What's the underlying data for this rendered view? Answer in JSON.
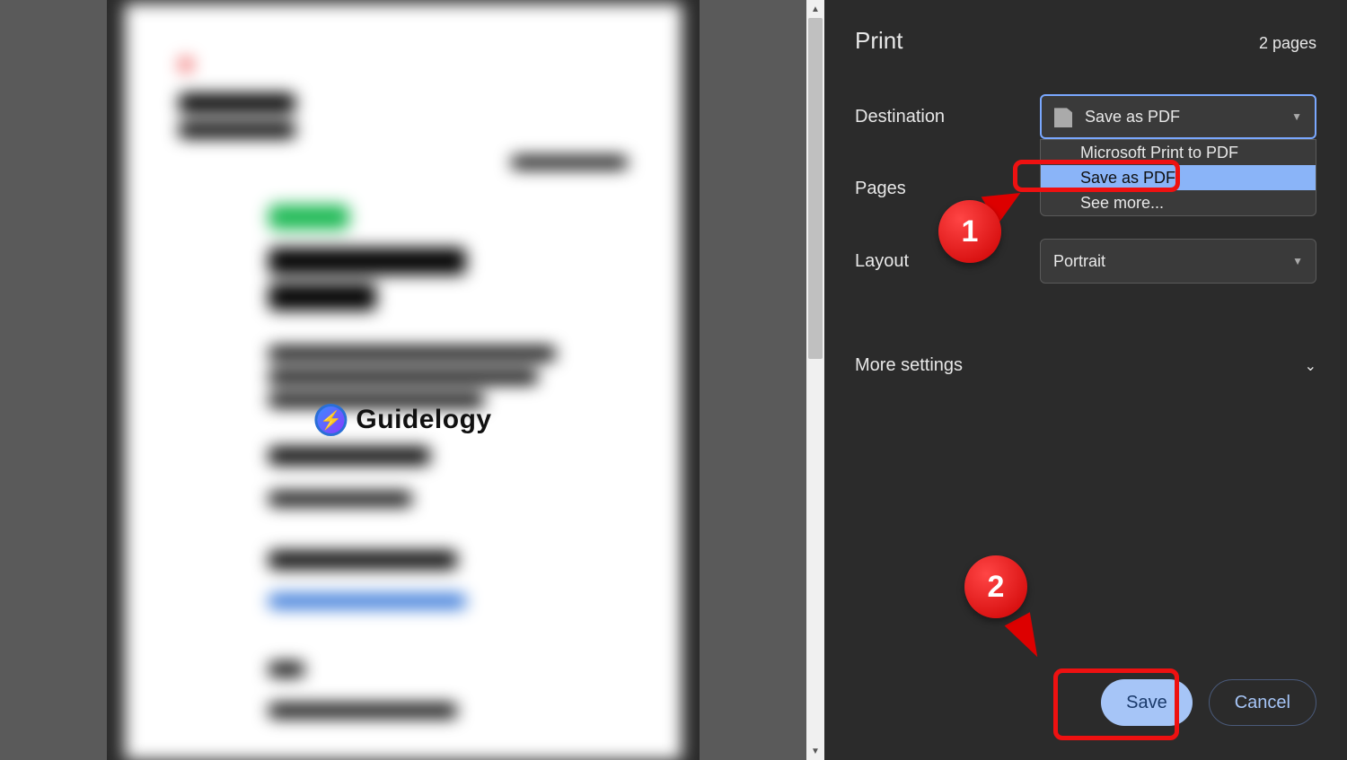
{
  "watermark": {
    "text": "Guidelogy"
  },
  "panel": {
    "title": "Print",
    "page_count": "2 pages",
    "destination": {
      "label": "Destination",
      "selected": "Save as PDF",
      "options": {
        "ms_print": "Microsoft Print to PDF",
        "save_pdf": "Save as PDF",
        "see_more": "See more..."
      }
    },
    "pages": {
      "label": "Pages"
    },
    "layout": {
      "label": "Layout",
      "selected": "Portrait"
    },
    "more_settings": "More settings",
    "buttons": {
      "save": "Save",
      "cancel": "Cancel"
    }
  },
  "annotations": {
    "step1": "1",
    "step2": "2"
  }
}
